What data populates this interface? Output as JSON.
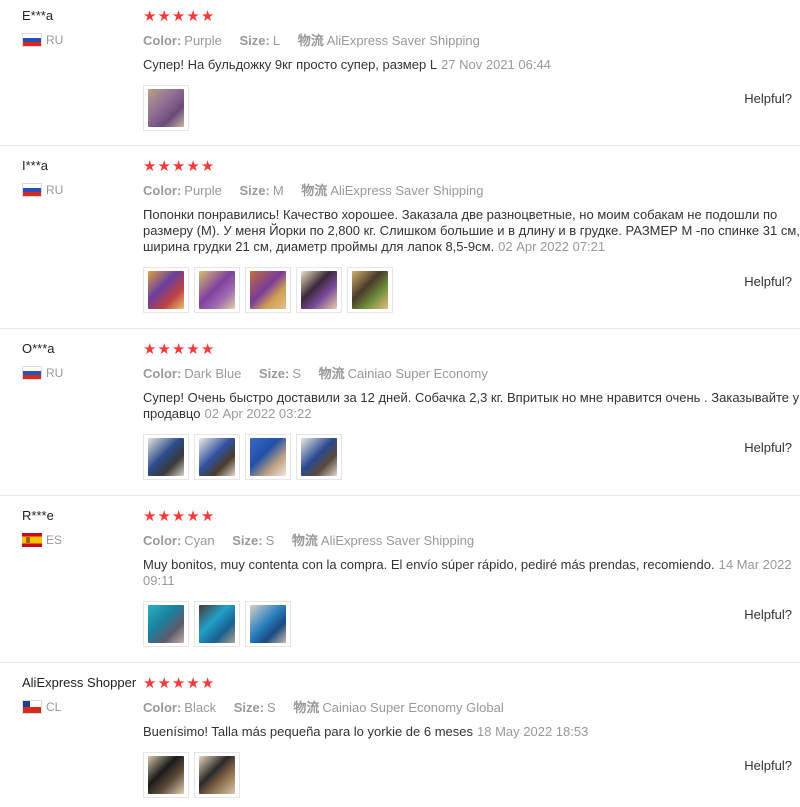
{
  "helpful_label": "Helpful?",
  "colors": {
    "star": "#f33b3b",
    "meta": "#999999",
    "divider": "#e8e8e8"
  },
  "reviews": [
    {
      "user": "E***a",
      "country": "RU",
      "flag": "flag-ru-icon",
      "stars": 5,
      "color_label": "Color:",
      "color_value": "Purple",
      "size_label": "Size:",
      "size_value": "L",
      "shipping_label": "物流",
      "shipping_value": "AliExpress Saver Shipping",
      "text": "Супер! На бульдожку 9кг просто супер, размер L",
      "date": "27 Nov 2021 06:44",
      "photos": 1
    },
    {
      "user": "I***a",
      "country": "RU",
      "flag": "flag-ru-icon",
      "stars": 5,
      "color_label": "Color:",
      "color_value": "Purple",
      "size_label": "Size:",
      "size_value": "M",
      "shipping_label": "物流",
      "shipping_value": "AliExpress Saver Shipping",
      "text": "Попонки понравились! Качество хорошее. Заказала две разноцветные, но моим собакам не подошли по размеру (М). У меня Йорки по 2,800 кг. Слишком большие и в длину и в грудке. РАЗМЕР М -по спинке 31 см, ширина грудки 21 см, диаметр проймы для лапок 8,5-9см.",
      "date": "02 Apr 2022 07:21",
      "photos": 5
    },
    {
      "user": "O***a",
      "country": "RU",
      "flag": "flag-ru-icon",
      "stars": 5,
      "color_label": "Color:",
      "color_value": "Dark Blue",
      "size_label": "Size:",
      "size_value": "S",
      "shipping_label": "物流",
      "shipping_value": "Cainiao Super Economy",
      "text": "Супер! Очень быстро доставили за 12 дней. Собачка 2,3 кг. Впритык но мне нравится очень . Заказывайте у продавцо",
      "date": "02 Apr 2022 03:22",
      "photos": 4
    },
    {
      "user": "R***e",
      "country": "ES",
      "flag": "flag-es-icon",
      "stars": 5,
      "color_label": "Color:",
      "color_value": "Cyan",
      "size_label": "Size:",
      "size_value": "S",
      "shipping_label": "物流",
      "shipping_value": "AliExpress Saver Shipping",
      "text": "Muy bonitos, muy contenta con la compra. El envío súper rápido, pediré más prendas, recomiendo.",
      "date": "14 Mar 2022 09:11",
      "photos": 3
    },
    {
      "user": "AliExpress Shopper",
      "country": "CL",
      "flag": "flag-cl-icon",
      "stars": 5,
      "color_label": "Color:",
      "color_value": "Black",
      "size_label": "Size:",
      "size_value": "S",
      "shipping_label": "物流",
      "shipping_value": "Cainiao Super Economy Global",
      "text": "Buenísimo! Talla más pequeña para lo yorkie de 6 meses",
      "date": "18 May 2022 18:53",
      "photos": 2
    }
  ]
}
